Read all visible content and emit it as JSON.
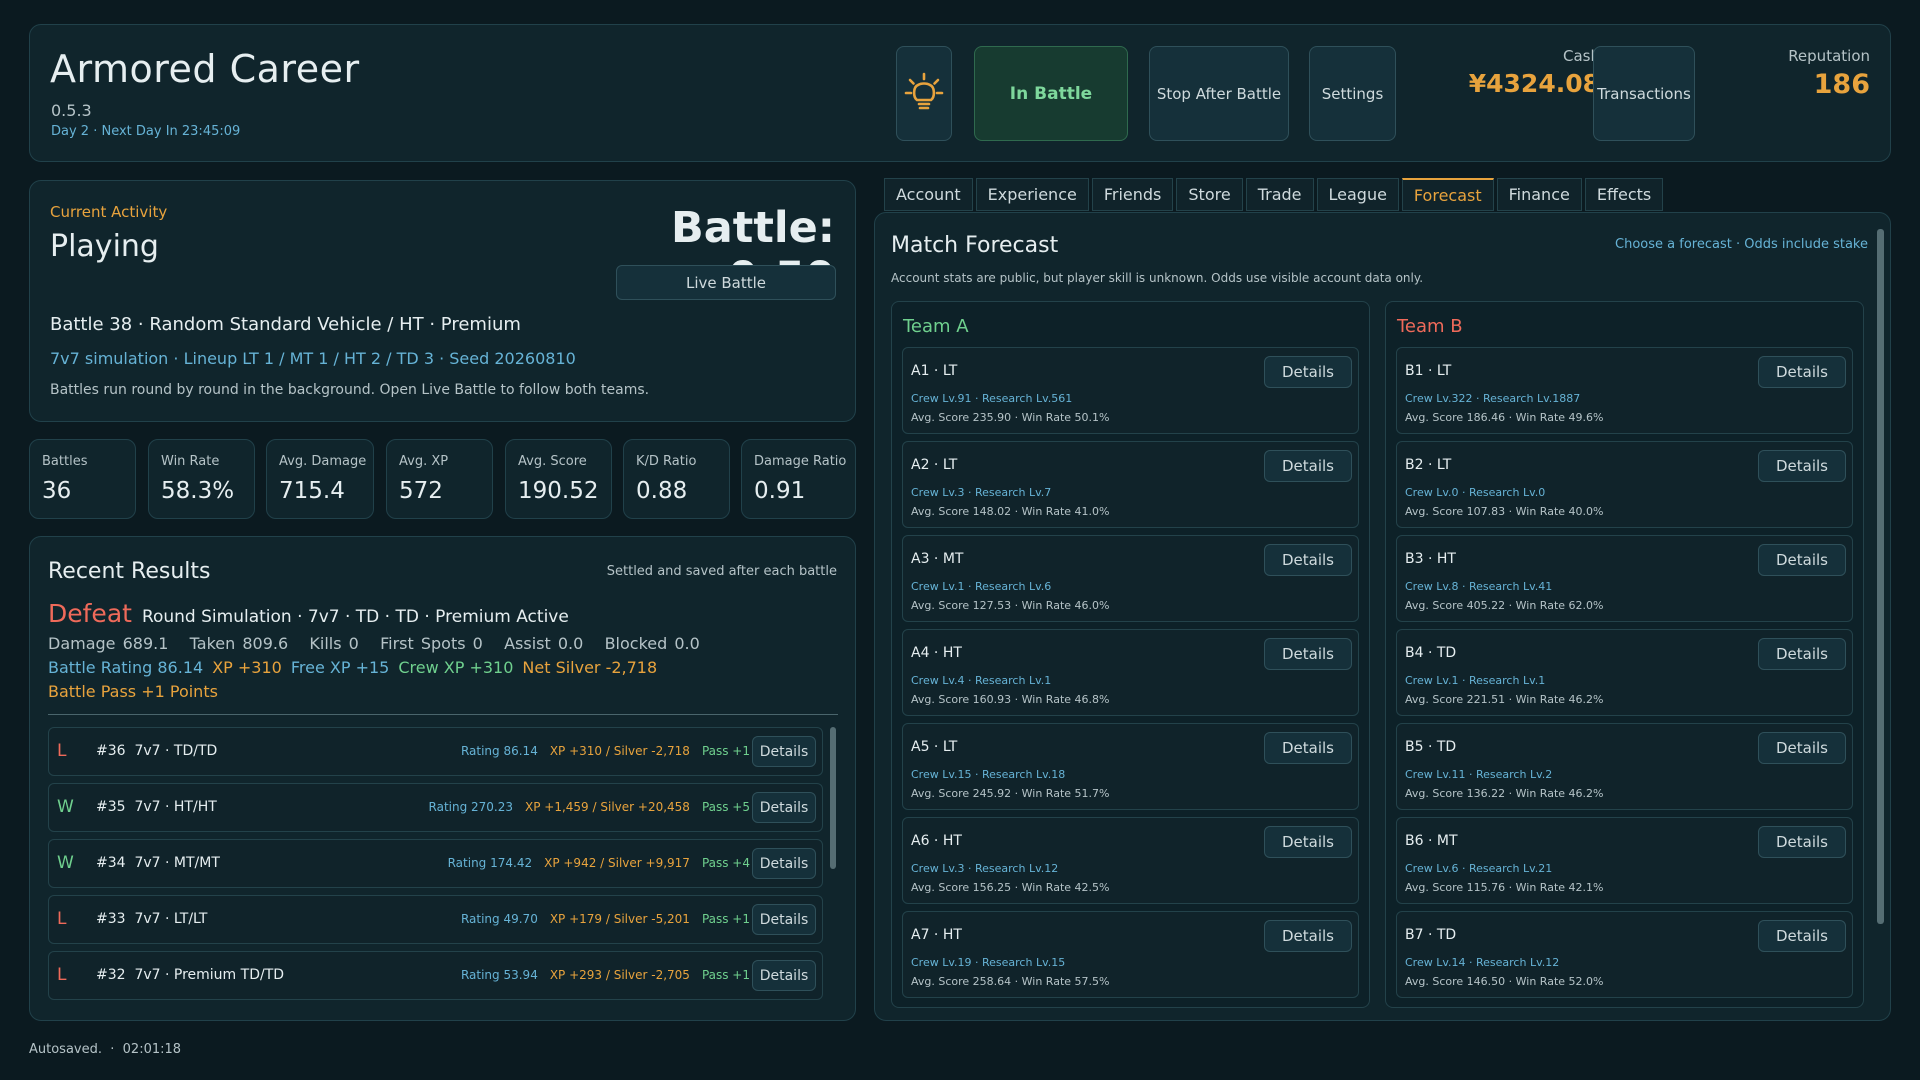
{
  "header": {
    "title": "Armored Career",
    "version": "0.5.3",
    "day_info": "Day 2 · Next Day In 23:45:09",
    "in_battle": "In Battle",
    "stop_after_battle": "Stop After Battle",
    "settings": "Settings",
    "cash_label": "Cash",
    "cash_value": "¥4324.08",
    "transactions": "Transactions",
    "reputation_label": "Reputation",
    "reputation_value": "186",
    "bulb_icon": "lightbulb-icon"
  },
  "activity": {
    "label": "Current Activity",
    "state": "Playing",
    "timer": "Battle: 0:50",
    "live_battle": "Live Battle",
    "battle_line": "Battle 38 · Random Standard Vehicle / HT · Premium",
    "simulation": "7v7 simulation · Lineup LT 1 / MT 1 / HT 2 / TD 3 · Seed 20260810",
    "note": "Battles run round by round in the background. Open Live Battle to follow both teams."
  },
  "stats": [
    {
      "label": "Battles",
      "value": "36"
    },
    {
      "label": "Win Rate",
      "value": "58.3%"
    },
    {
      "label": "Avg. Damage",
      "value": "715.4"
    },
    {
      "label": "Avg. XP",
      "value": "572"
    },
    {
      "label": "Avg. Score",
      "value": "190.52"
    },
    {
      "label": "K/D Ratio",
      "value": "0.88"
    },
    {
      "label": "Damage Ratio",
      "value": "0.91"
    }
  ],
  "recent": {
    "title": "Recent Results",
    "note": "Settled and saved after each battle",
    "last": {
      "outcome": "Defeat",
      "desc": "Round Simulation · 7v7 · TD · TD · Premium Active",
      "stats": "Damage 689.1   Taken 809.6   Kills 0   First Spots 0   Assist 0.0   Blocked 0.0",
      "rating": "Battle Rating 86.14",
      "xp": "XP +310",
      "free_xp": "Free XP +15",
      "crew_xp": "Crew XP +310",
      "net_silver": "Net Silver -2,718",
      "pass": "Battle Pass +1 Points"
    },
    "details_label": "Details",
    "rows": [
      {
        "outcome": "L",
        "name": "#36  7v7 · TD/TD",
        "rating": "Rating 86.14",
        "xp": "XP +310 / Silver -2,718",
        "pass": "Pass +1"
      },
      {
        "outcome": "W",
        "name": "#35  7v7 · HT/HT",
        "rating": "Rating 270.23",
        "xp": "XP +1,459 / Silver +20,458",
        "pass": "Pass +5"
      },
      {
        "outcome": "W",
        "name": "#34  7v7 · MT/MT",
        "rating": "Rating 174.42",
        "xp": "XP +942 / Silver +9,917",
        "pass": "Pass +4"
      },
      {
        "outcome": "L",
        "name": "#33  7v7 · LT/LT",
        "rating": "Rating 49.70",
        "xp": "XP +179 / Silver -5,201",
        "pass": "Pass +1"
      },
      {
        "outcome": "L",
        "name": "#32  7v7 · Premium TD/TD",
        "rating": "Rating 53.94",
        "xp": "XP +293 / Silver -2,705",
        "pass": "Pass +1"
      }
    ]
  },
  "tabs": [
    "Account",
    "Experience",
    "Friends",
    "Store",
    "Trade",
    "League",
    "Forecast",
    "Finance",
    "Effects"
  ],
  "active_tab": "Forecast",
  "forecast": {
    "title": "Match Forecast",
    "links": "Choose a forecast · Odds include stake",
    "note": "Account stats are public, but player skill is unknown. Odds use visible account data only.",
    "details_label": "Details",
    "team_a": {
      "name": "Team A",
      "players": [
        {
          "name": "A1 · LT",
          "crew": "Crew Lv.91 · Research Lv.561",
          "stats": "Avg. Score 235.90 · Win Rate 50.1%"
        },
        {
          "name": "A2 · LT",
          "crew": "Crew Lv.3 · Research Lv.7",
          "stats": "Avg. Score 148.02 · Win Rate 41.0%"
        },
        {
          "name": "A3 · MT",
          "crew": "Crew Lv.1 · Research Lv.6",
          "stats": "Avg. Score 127.53 · Win Rate 46.0%"
        },
        {
          "name": "A4 · HT",
          "crew": "Crew Lv.4 · Research Lv.1",
          "stats": "Avg. Score 160.93 · Win Rate 46.8%"
        },
        {
          "name": "A5 · LT",
          "crew": "Crew Lv.15 · Research Lv.18",
          "stats": "Avg. Score 245.92 · Win Rate 51.7%"
        },
        {
          "name": "A6 · HT",
          "crew": "Crew Lv.3 · Research Lv.12",
          "stats": "Avg. Score 156.25 · Win Rate 42.5%"
        },
        {
          "name": "A7 · HT",
          "crew": "Crew Lv.19 · Research Lv.15",
          "stats": "Avg. Score 258.64 · Win Rate 57.5%"
        }
      ]
    },
    "team_b": {
      "name": "Team B",
      "players": [
        {
          "name": "B1 · LT",
          "crew": "Crew Lv.322 · Research Lv.1887",
          "stats": "Avg. Score 186.46 · Win Rate 49.6%"
        },
        {
          "name": "B2 · LT",
          "crew": "Crew Lv.0 · Research Lv.0",
          "stats": "Avg. Score 107.83 · Win Rate 40.0%"
        },
        {
          "name": "B3 · HT",
          "crew": "Crew Lv.8 · Research Lv.41",
          "stats": "Avg. Score 405.22 · Win Rate 62.0%"
        },
        {
          "name": "B4 · TD",
          "crew": "Crew Lv.1 · Research Lv.1",
          "stats": "Avg. Score 221.51 · Win Rate 46.2%"
        },
        {
          "name": "B5 · TD",
          "crew": "Crew Lv.11 · Research Lv.2",
          "stats": "Avg. Score 136.22 · Win Rate 46.2%"
        },
        {
          "name": "B6 · MT",
          "crew": "Crew Lv.6 · Research Lv.21",
          "stats": "Avg. Score 115.76 · Win Rate 42.1%"
        },
        {
          "name": "B7 · TD",
          "crew": "Crew Lv.14 · Research Lv.12",
          "stats": "Avg. Score 146.50 · Win Rate 52.0%"
        }
      ]
    }
  },
  "footer": {
    "autosave": "Autosaved.  ·  02:01:18"
  },
  "colors": {
    "accent": "#e8a33d",
    "win": "#6fd08e",
    "loss": "#ef6a5a",
    "info": "#66b3d6",
    "team_a": "#6fd08e",
    "team_b": "#ef6a5a"
  }
}
